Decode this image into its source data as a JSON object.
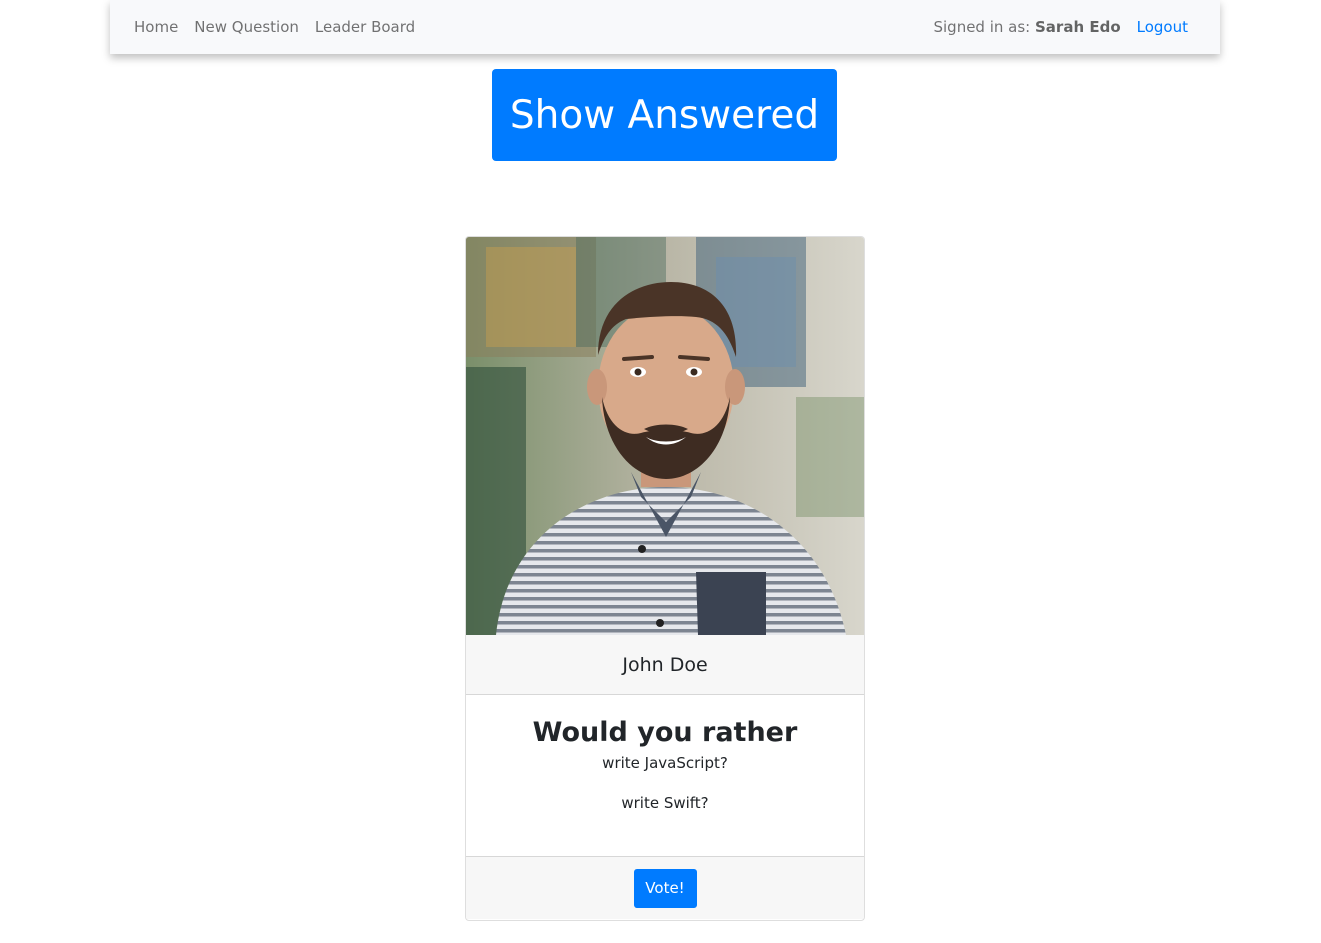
{
  "nav": {
    "links": [
      {
        "label": "Home"
      },
      {
        "label": "New Question"
      },
      {
        "label": "Leader Board"
      }
    ],
    "signed_in_prefix": "Signed in as: ",
    "user_name": "Sarah Edo",
    "logout_label": "Logout"
  },
  "toggle_button_label": "Show Answered",
  "question_card": {
    "author": "John Doe",
    "title": "Would you rather",
    "option_one": "write JavaScript?",
    "option_two": "write Swift?",
    "vote_label": "Vote!"
  },
  "colors": {
    "primary": "#007bff",
    "navbar_bg": "#f8f9fb",
    "card_section_bg": "#f7f7f7"
  }
}
